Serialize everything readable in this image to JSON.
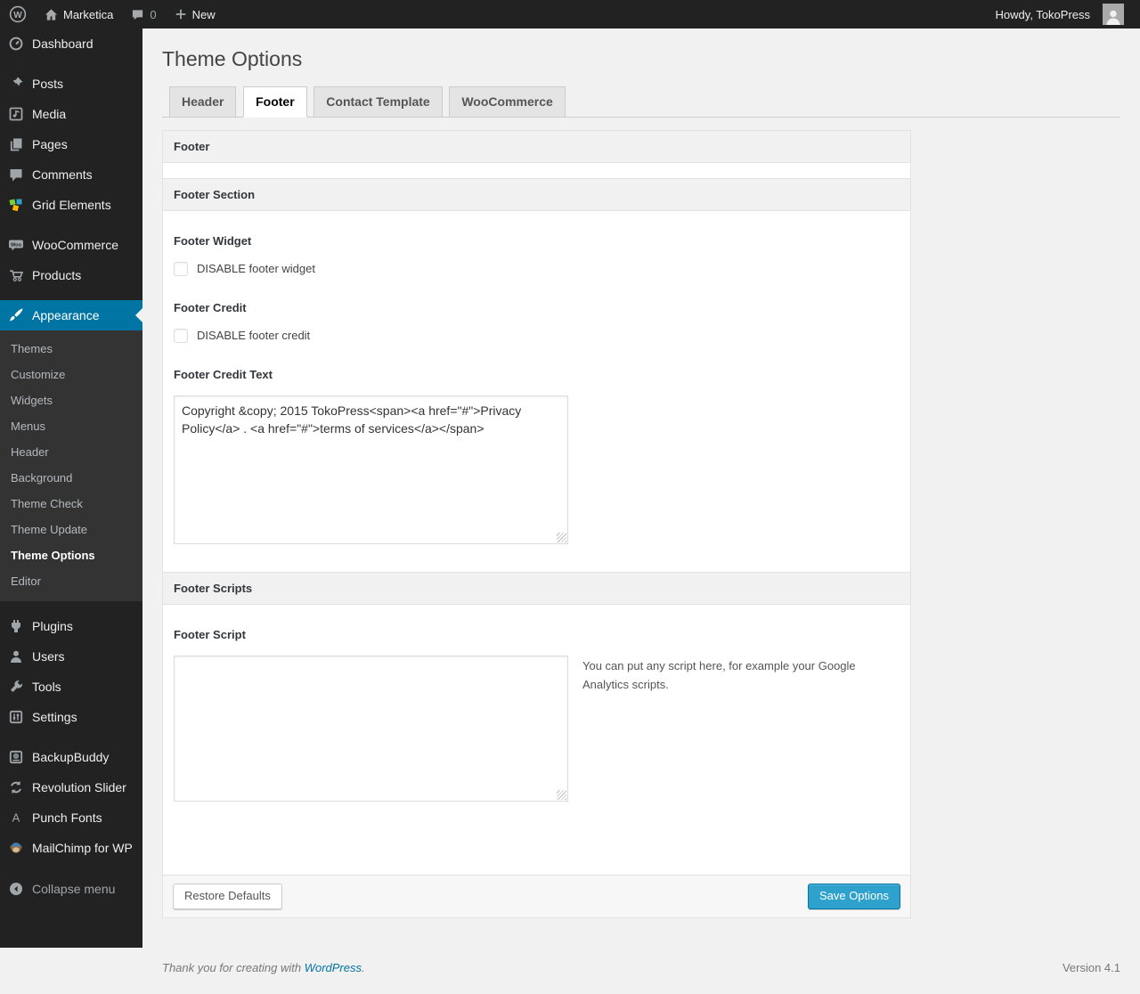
{
  "admin_bar": {
    "site_name": "Marketica",
    "comment_count": "0",
    "new_label": "New",
    "howdy_text": "Howdy, TokoPress"
  },
  "sidebar": {
    "items": [
      {
        "label": "Dashboard"
      },
      {
        "label": "Posts"
      },
      {
        "label": "Media"
      },
      {
        "label": "Pages"
      },
      {
        "label": "Comments"
      },
      {
        "label": "Grid Elements"
      },
      {
        "label": "WooCommerce"
      },
      {
        "label": "Products"
      },
      {
        "label": "Appearance"
      },
      {
        "label": "Plugins"
      },
      {
        "label": "Users"
      },
      {
        "label": "Tools"
      },
      {
        "label": "Settings"
      },
      {
        "label": "BackupBuddy"
      },
      {
        "label": "Revolution Slider"
      },
      {
        "label": "Punch Fonts"
      },
      {
        "label": "MailChimp for WP"
      }
    ],
    "appearance_submenu": [
      {
        "label": "Themes",
        "current": false
      },
      {
        "label": "Customize",
        "current": false
      },
      {
        "label": "Widgets",
        "current": false
      },
      {
        "label": "Menus",
        "current": false
      },
      {
        "label": "Header",
        "current": false
      },
      {
        "label": "Background",
        "current": false
      },
      {
        "label": "Theme Check",
        "current": false
      },
      {
        "label": "Theme Update",
        "current": false
      },
      {
        "label": "Theme Options",
        "current": true
      },
      {
        "label": "Editor",
        "current": false
      }
    ],
    "collapse_label": "Collapse menu"
  },
  "page": {
    "title": "Theme Options",
    "tabs": [
      {
        "label": "Header",
        "active": false
      },
      {
        "label": "Footer",
        "active": true
      },
      {
        "label": "Contact Template",
        "active": false
      },
      {
        "label": "WooCommerce",
        "active": false
      }
    ]
  },
  "panel": {
    "box_header": "Footer",
    "section_header": "Footer Section",
    "footer_widget_label": "Footer Widget",
    "footer_widget_checkbox_label": "DISABLE footer widget",
    "footer_widget_checked": false,
    "footer_credit_label": "Footer Credit",
    "footer_credit_checkbox_label": "DISABLE footer credit",
    "footer_credit_checked": false,
    "footer_credit_text_label": "Footer Credit Text",
    "footer_credit_text_value": "Copyright &copy; 2015 TokoPress<span><a href=\"#\">Privacy Policy</a> . <a href=\"#\">terms of services</a></span>",
    "scripts_header": "Footer Scripts",
    "footer_script_label": "Footer Script",
    "footer_script_value": "",
    "footer_script_hint": "You can put any script here, for example your Google Analytics scripts.",
    "restore_button_label": "Restore Defaults",
    "save_button_label": "Save Options"
  },
  "page_footer": {
    "thanks_prefix": "Thank you for creating with ",
    "wordpress_link_label": "WordPress",
    "thanks_suffix": ".",
    "version": "Version 4.1"
  },
  "colors": {
    "admin_bar_bg": "#222222",
    "menu_highlight": "#0074a2",
    "primary_button": "#2ea2cc",
    "primary_button_border": "#0074a2",
    "link": "#0074a2",
    "page_bg": "#f1f1f1",
    "panel_bg": "#ffffff",
    "section_header_bg": "#f1f1f1"
  }
}
